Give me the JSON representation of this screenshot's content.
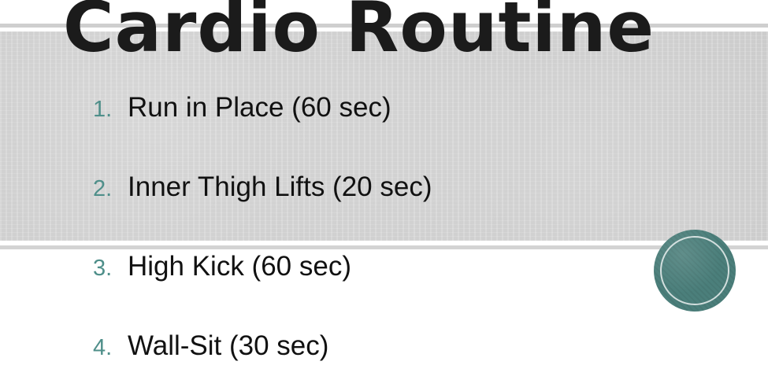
{
  "slide": {
    "title": "Cardio Routine",
    "accent_color": "#4f8f8a",
    "items": [
      {
        "number": "1.",
        "text": "Run in Place (60 sec)"
      },
      {
        "number": "2.",
        "text": "Inner Thigh Lifts (20 sec)"
      },
      {
        "number": "3.",
        "text": "High Kick (60 sec)"
      },
      {
        "number": "4.",
        "text": "Wall-Sit (30 sec)"
      }
    ]
  }
}
